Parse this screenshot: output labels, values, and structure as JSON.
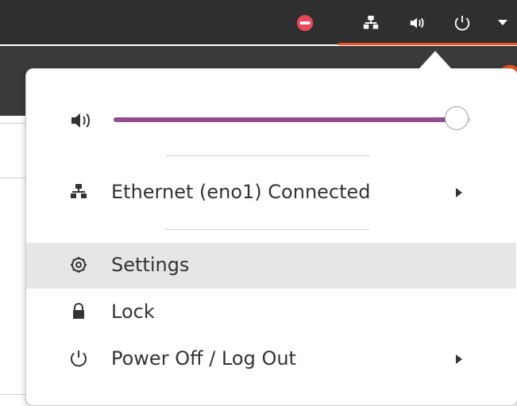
{
  "topbar": {
    "icons": [
      "status-red-icon",
      "network-icon",
      "volume-icon",
      "power-icon",
      "caret-down-icon"
    ],
    "accent_color": "#e95420"
  },
  "menu": {
    "volume": {
      "level_percent": 96,
      "slider_color": "#924d8b"
    },
    "items": [
      {
        "label": "Ethernet (eno1) Connected",
        "icon": "ethernet-icon",
        "has_submenu": true
      },
      {
        "label": "Settings",
        "icon": "settings-gear-icon",
        "has_submenu": false
      },
      {
        "label": "Lock",
        "icon": "lock-icon",
        "has_submenu": false
      },
      {
        "label": "Power Off / Log Out",
        "icon": "power-icon",
        "has_submenu": true
      }
    ]
  }
}
